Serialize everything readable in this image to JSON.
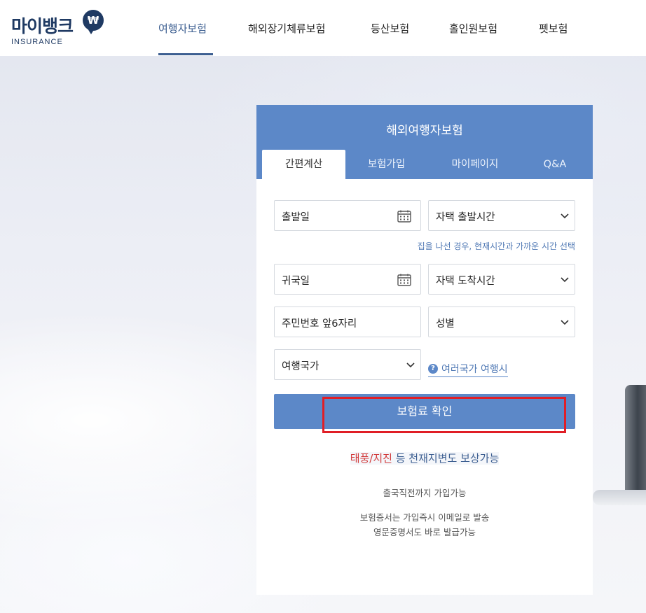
{
  "header": {
    "logo_text": "마이뱅크",
    "logo_badge": "₩",
    "logo_sub": "INSURANCE",
    "nav": [
      {
        "label": "여행자보험",
        "active": true
      },
      {
        "label": "해외장기체류보험",
        "active": false
      },
      {
        "label": "등산보험",
        "active": false
      },
      {
        "label": "홀인원보험",
        "active": false
      },
      {
        "label": "펫보험",
        "active": false
      }
    ]
  },
  "card": {
    "title": "해외여행자보험",
    "tabs": [
      {
        "label": "간편계산",
        "active": true
      },
      {
        "label": "보험가입",
        "active": false
      },
      {
        "label": "마이페이지",
        "active": false
      },
      {
        "label": "Q&A",
        "active": false
      }
    ],
    "form": {
      "departure_date": "출발일",
      "departure_time": "자택 출발시간",
      "departure_hint": "집을 나선 경우, 현재시간과 가까운 시간 선택",
      "return_date": "귀국일",
      "arrival_time": "자택 도착시간",
      "resident_number": "주민번호 앞6자리",
      "gender": "성별",
      "country": "여행국가",
      "multi_country_icon": "?",
      "multi_country_link": "여러국가 여행시",
      "submit": "보험료 확인"
    },
    "promo": {
      "highlight": "태풍/지진",
      "rest": " 등 천재지변도 보상가능"
    },
    "notes": {
      "line1": "출국직전까지 가입가능",
      "line2": "보험증서는 가입즉시 이메일로 발송",
      "line3": "영문증명서도 바로 발급가능"
    }
  },
  "colors": {
    "brand_navy": "#1f3a63",
    "card_blue": "#5c88c8",
    "nav_active": "#3d5f91",
    "highlight_red": "#e01e26"
  }
}
